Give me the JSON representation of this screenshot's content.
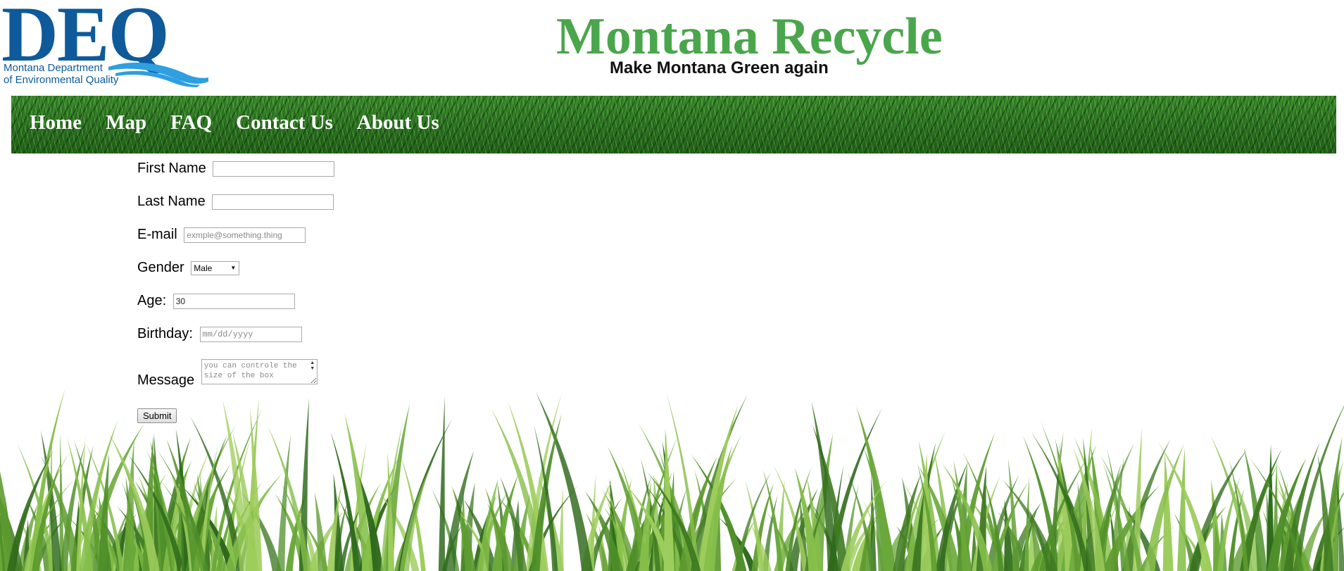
{
  "logo": {
    "letters": "DEQ",
    "line1": "Montana Department",
    "line2": "of Environmental Quality",
    "color": "#0e5a9a",
    "wave_color": "#2e9fe0"
  },
  "header": {
    "title": "Montana Recycle",
    "tagline": "Make Montana Green again",
    "title_color": "#4aa64c"
  },
  "nav": {
    "items": [
      {
        "label": "Home"
      },
      {
        "label": "Map"
      },
      {
        "label": "FAQ"
      },
      {
        "label": "Contact Us"
      },
      {
        "label": "About Us"
      }
    ]
  },
  "form": {
    "first_name": {
      "label": "First Name",
      "value": ""
    },
    "last_name": {
      "label": "Last Name",
      "value": ""
    },
    "email": {
      "label": "E-mail",
      "placeholder": "exmple@something.thing",
      "value": ""
    },
    "gender": {
      "label": "Gender",
      "selected": "Male"
    },
    "age": {
      "label": "Age:",
      "value": "30"
    },
    "birthday": {
      "label": "Birthday:",
      "placeholder": "mm/dd/yyyy"
    },
    "message": {
      "label": "Message",
      "placeholder": "you can controle the size of the box"
    },
    "submit_label": "Submit"
  }
}
